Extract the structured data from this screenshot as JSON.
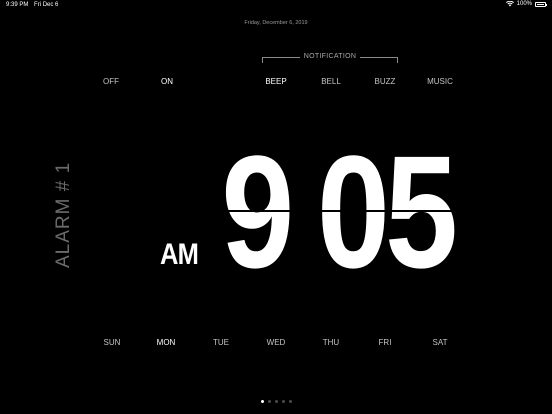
{
  "status_bar": {
    "time": "9:39 PM",
    "date": "Fri Dec 6",
    "battery": "100%"
  },
  "date_line": "Friday, December 6, 2019",
  "power": {
    "options": [
      "OFF",
      "ON"
    ],
    "selected": "ON"
  },
  "notification": {
    "label": "NOTIFICATION",
    "options": [
      "BEEP",
      "BELL",
      "BUZZ",
      "MUSIC"
    ],
    "selected": "BEEP"
  },
  "alarm": {
    "label": "ALARM # 1",
    "meridiem": "AM",
    "hour": "9",
    "minute": "05"
  },
  "days": {
    "options": [
      "SUN",
      "MON",
      "TUE",
      "WED",
      "THU",
      "FRI",
      "SAT"
    ],
    "selected": "MON"
  },
  "pages": {
    "count": 5,
    "current": 1
  },
  "colors": {
    "background": "#000000",
    "text": "#ffffff",
    "dim_text": "#6a6a6a"
  },
  "icons": [
    "wifi-icon",
    "battery-icon"
  ]
}
